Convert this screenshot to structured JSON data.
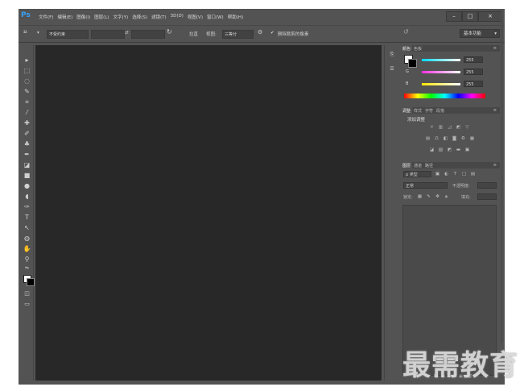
{
  "app": {
    "logo": "Ps"
  },
  "menubar": {
    "items": [
      "文件(F)",
      "编辑(E)",
      "图像(I)",
      "图层(L)",
      "文字(Y)",
      "选择(S)",
      "滤镜(T)",
      "3D(D)",
      "视图(V)",
      "窗口(W)",
      "帮助(H)"
    ],
    "window_buttons": [
      "–",
      "□",
      "×"
    ]
  },
  "options_bar": {
    "ratio_select": "不受约束",
    "rotate_label": "拉直",
    "view_label": "视图:",
    "view_select": "三等分",
    "delete_cropped_label": "删除裁剪的像素",
    "workspace": "基本功能"
  },
  "panels": {
    "color_tabs": [
      "颜色",
      "色板"
    ],
    "color_sliders": [
      {
        "label": "R",
        "value": "255",
        "color": "#00d8ff"
      },
      {
        "label": "G",
        "value": "255",
        "color": "#ff2ee0"
      },
      {
        "label": "B",
        "value": "255",
        "color": "#ffe600"
      }
    ],
    "adjust_tabs": [
      "调整",
      "样式",
      "字符",
      "段落"
    ],
    "adjust_title": "添加调整",
    "layers_tabs": [
      "图层",
      "通道",
      "路径"
    ],
    "layers_kind": "ρ 类型",
    "blend_mode": "正常",
    "opacity_label": "不透明度:",
    "lock_label": "锁定:",
    "fill_label": "填充:"
  },
  "watermark": "最需教育"
}
